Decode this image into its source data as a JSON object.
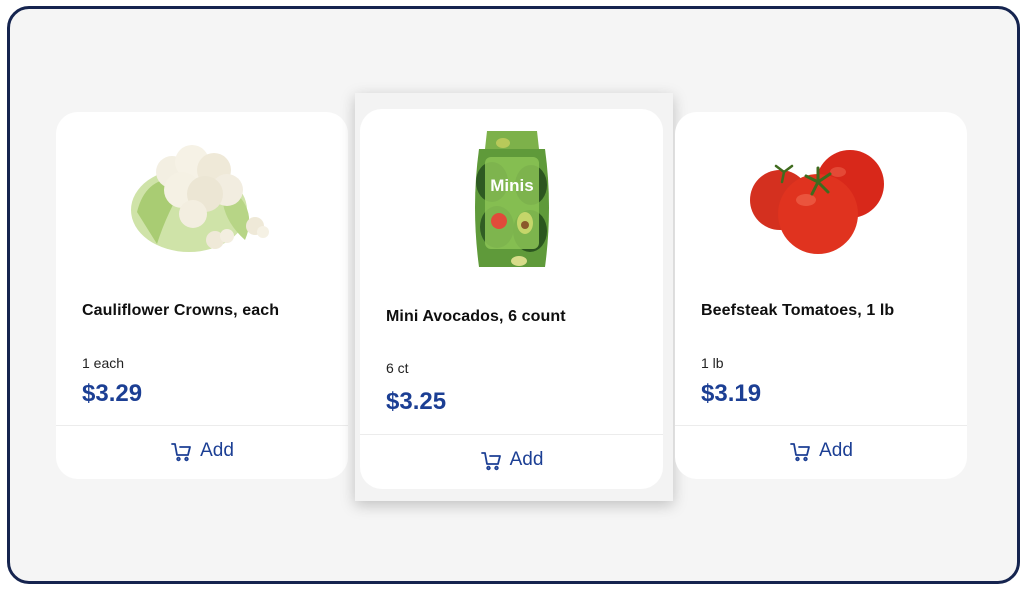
{
  "products": [
    {
      "name": "Cauliflower Crowns, each",
      "unit": "1 each",
      "price": "$3.29",
      "add_label": "Add",
      "image_icon": "cauliflower-image"
    },
    {
      "name": "Mini Avocados, 6 count",
      "unit": "6 ct",
      "price": "$3.25",
      "add_label": "Add",
      "image_icon": "mini-avocados-bag-image",
      "package_text": "Minis"
    },
    {
      "name": "Beefsteak Tomatoes, 1 lb",
      "unit": "1 lb",
      "price": "$3.19",
      "add_label": "Add",
      "image_icon": "tomatoes-image"
    }
  ],
  "colors": {
    "price": "#1c3f94",
    "frame_border": "#15244f",
    "background": "#f5f5f5"
  }
}
